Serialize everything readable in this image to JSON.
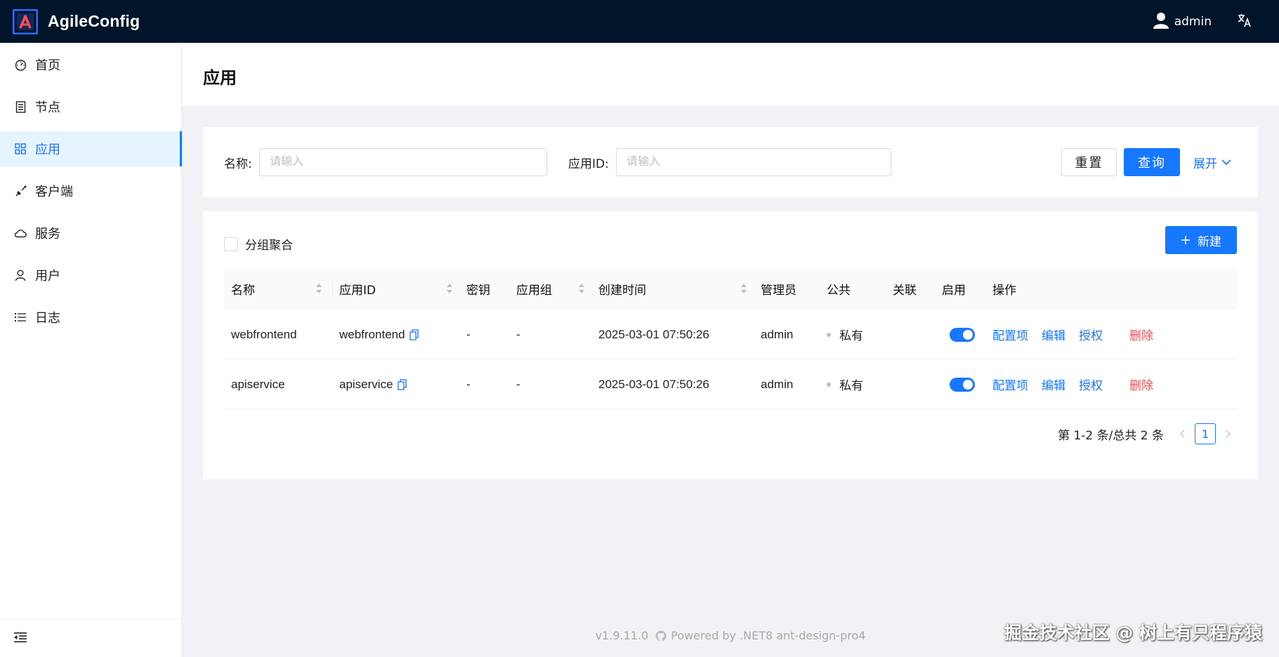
{
  "app": {
    "title": "AgileConfig"
  },
  "header": {
    "user_name": "admin"
  },
  "sidebar": {
    "items": [
      {
        "label": "首页",
        "icon": "dashboard-icon",
        "active": false
      },
      {
        "label": "节点",
        "icon": "node-icon",
        "active": false
      },
      {
        "label": "应用",
        "icon": "app-grid-icon",
        "active": true
      },
      {
        "label": "客户端",
        "icon": "client-icon",
        "active": false
      },
      {
        "label": "服务",
        "icon": "cloud-icon",
        "active": false
      },
      {
        "label": "用户",
        "icon": "user-icon",
        "active": false
      },
      {
        "label": "日志",
        "icon": "list-icon",
        "active": false
      }
    ]
  },
  "page": {
    "title": "应用"
  },
  "search": {
    "name_label": "名称:",
    "name_placeholder": "请输入",
    "appid_label": "应用ID:",
    "appid_placeholder": "请输入",
    "reset_label": "重置",
    "query_label": "查询",
    "expand_label": "展开"
  },
  "table": {
    "group_label": "分组聚合",
    "new_label": "新建",
    "columns": [
      "名称",
      "应用ID",
      "密钥",
      "应用组",
      "创建时间",
      "管理员",
      "公共",
      "关联",
      "启用",
      "操作"
    ],
    "rows": [
      {
        "name": "webfrontend",
        "app_id": "webfrontend",
        "secret": "-",
        "group": "-",
        "created": "2025-03-01 07:50:26",
        "admin": "admin",
        "public": "私有",
        "related": "",
        "enabled": true
      },
      {
        "name": "apiservice",
        "app_id": "apiservice",
        "secret": "-",
        "group": "-",
        "created": "2025-03-01 07:50:26",
        "admin": "admin",
        "public": "私有",
        "related": "",
        "enabled": true
      }
    ],
    "actions": {
      "config": "配置项",
      "edit": "编辑",
      "auth": "授权",
      "delete": "删除"
    }
  },
  "pagination": {
    "summary": "第 1-2 条/总共 2 条",
    "current": "1"
  },
  "footer": {
    "version": "v1.9.11.0",
    "powered": "Powered by .NET8 ant-design-pro4"
  },
  "watermark": "掘金技术社区 @ 树上有只程序猿",
  "colors": {
    "header_bg": "#001529",
    "primary": "#1677ff",
    "danger": "#ff4d4f",
    "active_bg": "#e6f4ff"
  }
}
